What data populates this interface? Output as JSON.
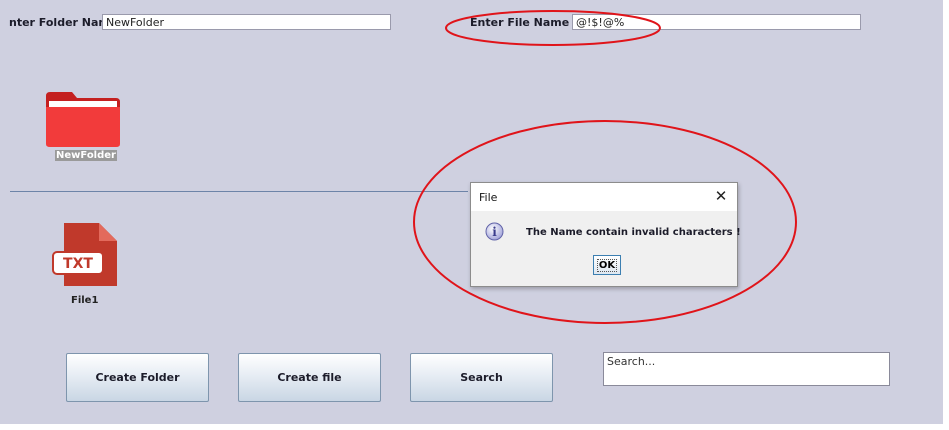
{
  "form": {
    "folder_label": "nter Folder Name",
    "folder_value": "NewFolder",
    "file_label": "Enter File Name",
    "file_value": "@!$!@%"
  },
  "icons": {
    "folder_name": "NewFolder",
    "folder_icon": "folder-icon",
    "file_name": "File1",
    "file_icon": "txt-file-icon",
    "file_badge": "TXT"
  },
  "buttons": {
    "create_folder": "Create Folder",
    "create_file": "Create file",
    "search": "Search"
  },
  "search": {
    "placeholder": "Search..."
  },
  "dialog": {
    "title": "File",
    "close_glyph": "✕",
    "message": "The Name contain invalid characters !",
    "ok_label": "OK",
    "info_icon": "info-icon",
    "info_glyph": "i"
  },
  "colors": {
    "panel_bg": "#cfd0e0",
    "annotation_red": "#e0141a",
    "folder_red": "#f23b3b",
    "file_red": "#c0392b"
  }
}
